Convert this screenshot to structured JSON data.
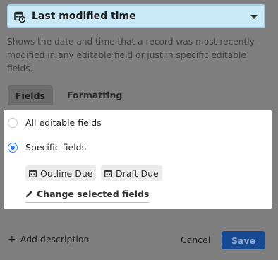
{
  "field_type": {
    "label": "Last modified time",
    "icon": "calendar-clock-icon"
  },
  "description": "Shows the date and time that a record was most recently modified in any editable field or just in specific editable fields.",
  "tabs": [
    {
      "label": "Fields",
      "active": true
    },
    {
      "label": "Formatting",
      "active": false
    }
  ],
  "options": {
    "all_fields": {
      "label": "All editable fields",
      "selected": false
    },
    "specific_fields": {
      "label": "Specific fields",
      "selected": true
    },
    "selected_fields": [
      {
        "label": "Outline Due",
        "icon": "date-field-icon"
      },
      {
        "label": "Draft Due",
        "icon": "date-field-icon"
      }
    ],
    "change_link": "Change selected fields"
  },
  "footer": {
    "add_description": "Add description",
    "cancel": "Cancel",
    "save": "Save"
  },
  "colors": {
    "accent": "#2d7ff9",
    "save_button": "#184a93",
    "type_select_bg": "#c9e9f7"
  }
}
